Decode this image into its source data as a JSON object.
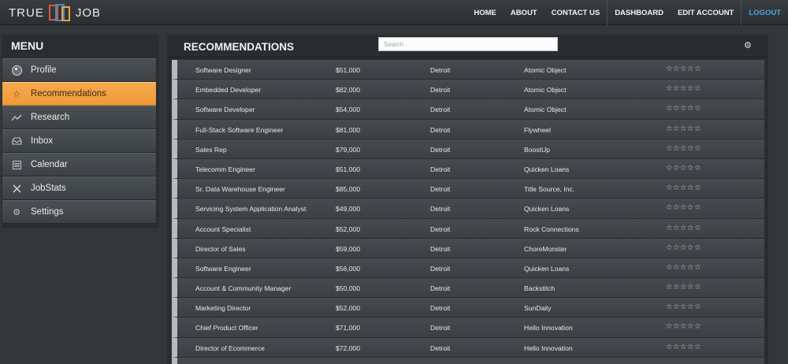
{
  "brand": {
    "left": "TRUE",
    "right": "JOB"
  },
  "nav": [
    {
      "label": "HOME",
      "name": "nav-home"
    },
    {
      "label": "ABOUT",
      "name": "nav-about"
    },
    {
      "label": "CONTACT US",
      "name": "nav-contact-us"
    },
    {
      "label": "DASHBOARD",
      "name": "nav-dashboard"
    },
    {
      "label": "EDIT ACCOUNT",
      "name": "nav-edit-account"
    },
    {
      "label": "LOGOUT",
      "name": "nav-logout"
    }
  ],
  "sidebar": {
    "title": "MENU",
    "items": [
      {
        "label": "Profile",
        "icon": "profile-icon",
        "active": false
      },
      {
        "label": "Recommendations",
        "icon": "star-icon",
        "active": true
      },
      {
        "label": "Research",
        "icon": "trend-chart-icon",
        "active": false
      },
      {
        "label": "Inbox",
        "icon": "inbox-icon",
        "active": false
      },
      {
        "label": "Calendar",
        "icon": "calendar-icon",
        "active": false
      },
      {
        "label": "JobStats",
        "icon": "tools-icon",
        "active": false
      },
      {
        "label": "Settings",
        "icon": "gear-icon",
        "active": false
      }
    ]
  },
  "main": {
    "title": "RECOMMENDATIONS",
    "search_placeholder": "Search",
    "gear_icon": "gear-icon",
    "rating_display": "☆☆☆☆☆",
    "rows": [
      {
        "title": "Software Designer",
        "salary": "$51,000",
        "location": "Detroit",
        "company": "Atomic Object"
      },
      {
        "title": "Embedded Developer",
        "salary": "$82,000",
        "location": "Detroit",
        "company": "Atomic Object"
      },
      {
        "title": "Software Developer",
        "salary": "$54,000",
        "location": "Detroit",
        "company": "Atomic Object"
      },
      {
        "title": "Full-Stack Software Engineer",
        "salary": "$81,000",
        "location": "Detroit",
        "company": "Flywheel"
      },
      {
        "title": "Sales Rep",
        "salary": "$79,000",
        "location": "Detroit",
        "company": "BoostUp"
      },
      {
        "title": "Telecomm Engineer",
        "salary": "$51,000",
        "location": "Detroit",
        "company": "Quicken Loans"
      },
      {
        "title": "Sr. Data Warehouse Engineer",
        "salary": "$85,000",
        "location": "Detroit",
        "company": "Title Source, Inc."
      },
      {
        "title": "Servicing System Application Analyst",
        "salary": "$49,000",
        "location": "Detroit",
        "company": "Quicken Loans"
      },
      {
        "title": "Account Specialist",
        "salary": "$52,000",
        "location": "Detroit",
        "company": "Rock Connections"
      },
      {
        "title": "Director of Sales",
        "salary": "$59,000",
        "location": "Detroit",
        "company": "ChoreMonster"
      },
      {
        "title": "Software Engineer",
        "salary": "$56,000",
        "location": "Detroit",
        "company": "Quicken Loans"
      },
      {
        "title": "Account & Community Manager",
        "salary": "$50,000",
        "location": "Detroit",
        "company": "Backstitch"
      },
      {
        "title": "Marketing Director",
        "salary": "$52,000",
        "location": "Detroit",
        "company": "SunDaily"
      },
      {
        "title": "Chief Product Officer",
        "salary": "$71,000",
        "location": "Detroit",
        "company": "Hello Innovation"
      },
      {
        "title": "Director of Ecommerce",
        "salary": "$72,000",
        "location": "Detroit",
        "company": "Hello Innovation"
      },
      {
        "title": "",
        "salary": "",
        "location": "",
        "company": ""
      }
    ]
  },
  "colors": {
    "accent": "#f5a345",
    "logout": "#43a7e6",
    "background": "#33373a"
  }
}
